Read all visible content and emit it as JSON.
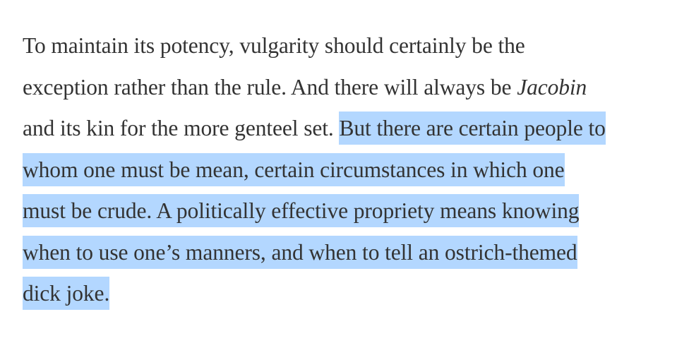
{
  "article": {
    "lines": {
      "l1": "To maintain its potency, vulgarity should certainly be the",
      "l2_before": "exception rather than the rule. And there will always be ",
      "l2_em": "Jacobin",
      "l3_plain": "and its kin for the more genteel set. ",
      "l3_selected": "But there are certain people to",
      "l4": "whom one must be mean, certain circumstances in which one",
      "l5": "must be crude. A politically effective propriety means knowing",
      "l6": "when to use one’s manners, and when to tell an ostrich-themed",
      "l7": "dick joke."
    },
    "selection_color": "#b3d7ff",
    "text_color": "#333333"
  }
}
